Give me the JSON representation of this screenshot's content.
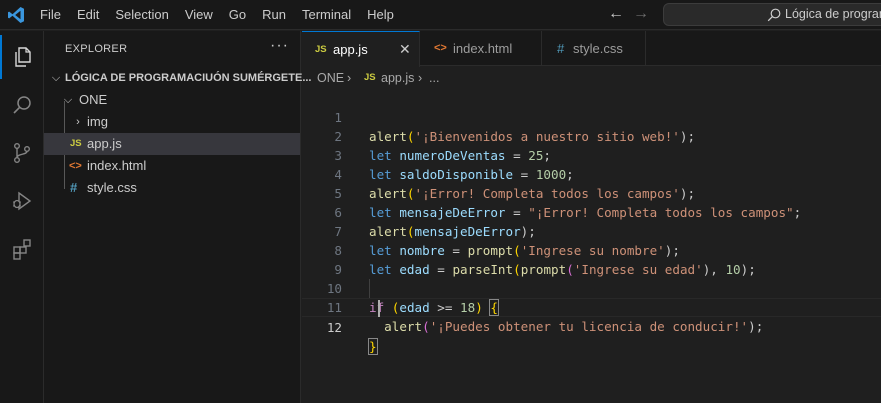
{
  "titlebar": {
    "menu": [
      "File",
      "Edit",
      "Selection",
      "View",
      "Go",
      "Run",
      "Terminal",
      "Help"
    ],
    "search_text": "Lógica de program"
  },
  "colors": {
    "accent": "#0078d4",
    "js_icon": "#cbcb41",
    "html_icon": "#e37933",
    "css_icon": "#519aba"
  },
  "activity_icons": [
    "explorer-icon",
    "search-icon",
    "source-control-icon",
    "run-debug-icon",
    "extensions-icon"
  ],
  "sidebar": {
    "title": "EXPLORER",
    "more": "···",
    "workspace": "LÓGICA DE PROGRAMACIUÓN SUMÉRGETE...",
    "folder": "ONE",
    "items": [
      {
        "icon": "",
        "label": "img",
        "type": "folder"
      },
      {
        "icon": "JS",
        "label": "app.js",
        "type": "js"
      },
      {
        "icon": "<>",
        "label": "index.html",
        "type": "html"
      },
      {
        "icon": "#",
        "label": "style.css",
        "type": "css"
      }
    ]
  },
  "tabs": [
    {
      "icon": "JS",
      "label": "app.js",
      "close": "✕"
    },
    {
      "icon": "<>",
      "label": "index.html"
    },
    {
      "icon": "#",
      "label": "style.css"
    }
  ],
  "breadcrumb": {
    "folder": "ONE",
    "sep1": "›",
    "file_icon": "JS",
    "file": "app.js",
    "sep2": "›",
    "tail": "..."
  },
  "editor": {
    "current_line": 12,
    "lines": [
      {
        "n": "1"
      },
      {
        "n": "2"
      },
      {
        "n": "3"
      },
      {
        "n": "4"
      },
      {
        "n": "5"
      },
      {
        "n": "6"
      },
      {
        "n": "7"
      },
      {
        "n": "8"
      },
      {
        "n": "9"
      },
      {
        "n": "10"
      },
      {
        "n": "11"
      },
      {
        "n": "12"
      }
    ],
    "tokens": {
      "l1": [
        "alert",
        "(",
        "'¡Bienvenidos a nuestro sitio web!'",
        ");"
      ],
      "l2": [
        "let",
        " ",
        "numeroDeVentas",
        " = ",
        "25",
        ";"
      ],
      "l3": [
        "let",
        " ",
        "saldoDisponible",
        " = ",
        "1000",
        ";"
      ],
      "l4": [
        "alert",
        "(",
        "'¡Error! Completa todos los campos'",
        ");"
      ],
      "l5": [
        "let",
        " ",
        "mensajeDeError",
        " = ",
        "\"¡Error! Completa todos los campos\"",
        ";"
      ],
      "l6": [
        "alert",
        "(",
        "mensajeDeError",
        ");"
      ],
      "l7": [
        "let",
        " ",
        "nombre",
        " = ",
        "prompt",
        "(",
        "'Ingrese su nombre'",
        ");"
      ],
      "l8": [
        "let",
        " ",
        "edad",
        " = ",
        "parseInt",
        "(",
        "prompt",
        "(",
        "'Ingrese su edad'",
        "), ",
        "10",
        ");"
      ],
      "l10": [
        "if",
        " ",
        "(",
        "edad",
        " >= ",
        "18",
        ") ",
        "{"
      ],
      "l11": [
        "  ",
        "alert",
        "(",
        "'¡Puedes obtener tu licencia de conducir!'",
        ");"
      ],
      "l12": [
        "}"
      ]
    }
  }
}
